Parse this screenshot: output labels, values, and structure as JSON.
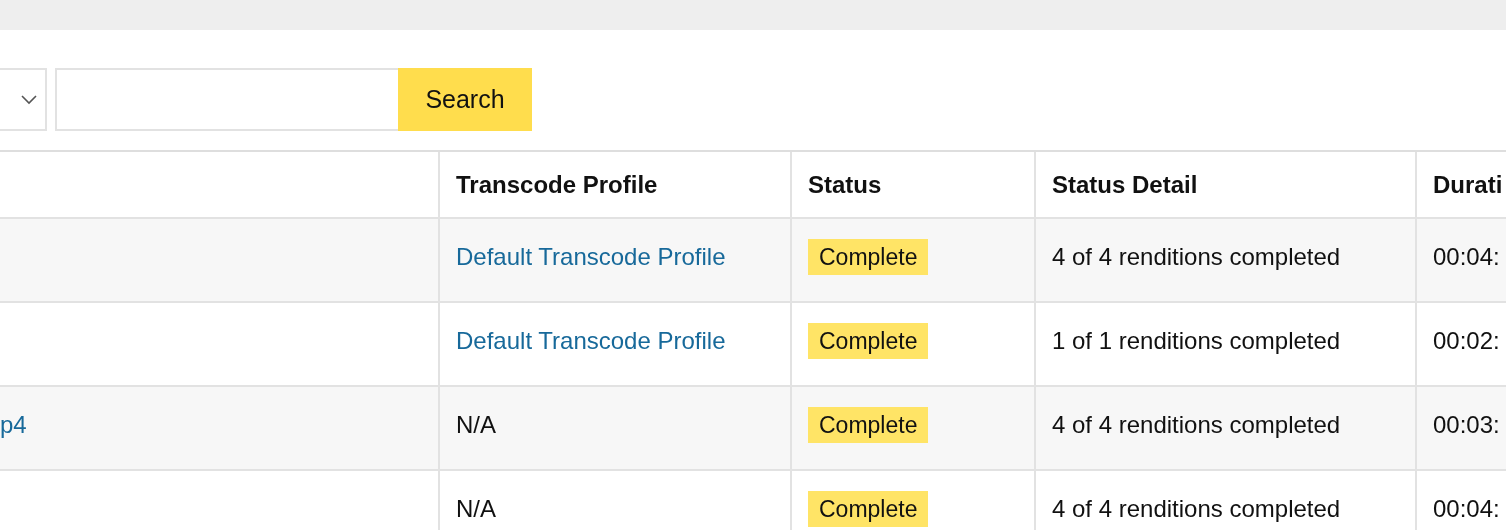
{
  "search": {
    "button": "Search"
  },
  "table": {
    "columns": [
      {},
      {
        "label": "Transcode Profile"
      },
      {
        "label": "Status"
      },
      {
        "label": "Status Detail"
      },
      {
        "label": "Durati"
      }
    ],
    "rows": [
      {
        "transcode_profile": "Default Transcode Profile",
        "profile_is_link": true,
        "status": "Complete",
        "status_detail": "4 of 4 renditions completed",
        "duration": "00:04:"
      },
      {
        "transcode_profile": "Default Transcode Profile",
        "profile_is_link": true,
        "status": "Complete",
        "status_detail": "1 of 1 renditions completed",
        "duration": "00:02:"
      },
      {
        "column_1": "p4",
        "transcode_profile": "N/A",
        "profile_is_link": false,
        "status": "Complete",
        "status_detail": "4 of 4 renditions completed",
        "duration": "00:03:"
      },
      {
        "transcode_profile": "N/A",
        "profile_is_link": false,
        "status": "Complete",
        "status_detail": "4 of 4 renditions completed",
        "duration": "00:04:"
      }
    ]
  }
}
